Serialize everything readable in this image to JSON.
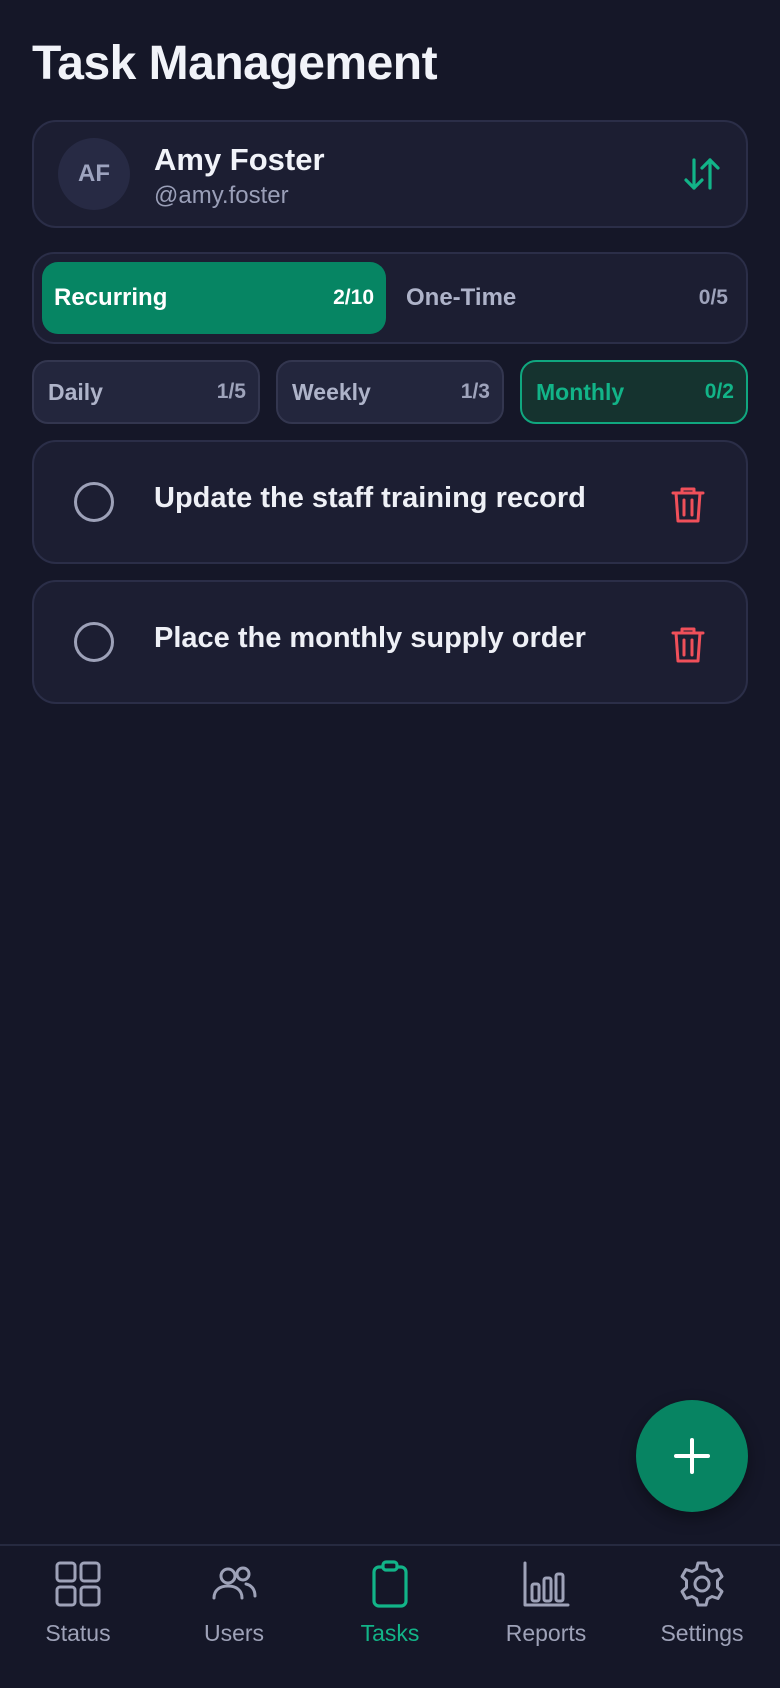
{
  "header": {
    "title": "Task Management"
  },
  "user": {
    "initials": "AF",
    "name": "Amy Foster",
    "handle": "@amy.foster",
    "switch_icon": "swap-vertical-icon"
  },
  "task_type_tabs": [
    {
      "label": "Recurring",
      "count": "2/10",
      "active": true
    },
    {
      "label": "One-Time",
      "count": "0/5",
      "active": false
    }
  ],
  "frequency_filters": [
    {
      "label": "Daily",
      "count": "1/5",
      "active": false
    },
    {
      "label": "Weekly",
      "count": "1/3",
      "active": false
    },
    {
      "label": "Monthly",
      "count": "0/2",
      "active": true
    }
  ],
  "tasks": [
    {
      "text": "Update the staff training record",
      "done": false
    },
    {
      "text": "Place the monthly supply order",
      "done": false
    }
  ],
  "fab": {
    "icon": "plus-icon"
  },
  "bottom_nav": [
    {
      "label": "Status",
      "icon": "grid-icon",
      "active": false
    },
    {
      "label": "Users",
      "icon": "users-icon",
      "active": false
    },
    {
      "label": "Tasks",
      "icon": "clipboard-icon",
      "active": true
    },
    {
      "label": "Reports",
      "icon": "bar-chart-icon",
      "active": false
    },
    {
      "label": "Settings",
      "icon": "gear-icon",
      "active": false
    }
  ],
  "colors": {
    "background": "#151728",
    "card": "#1c1e32",
    "accent": "#068563",
    "accent_text": "#12b488",
    "danger": "#f0505a",
    "muted": "#9ea2b8"
  }
}
